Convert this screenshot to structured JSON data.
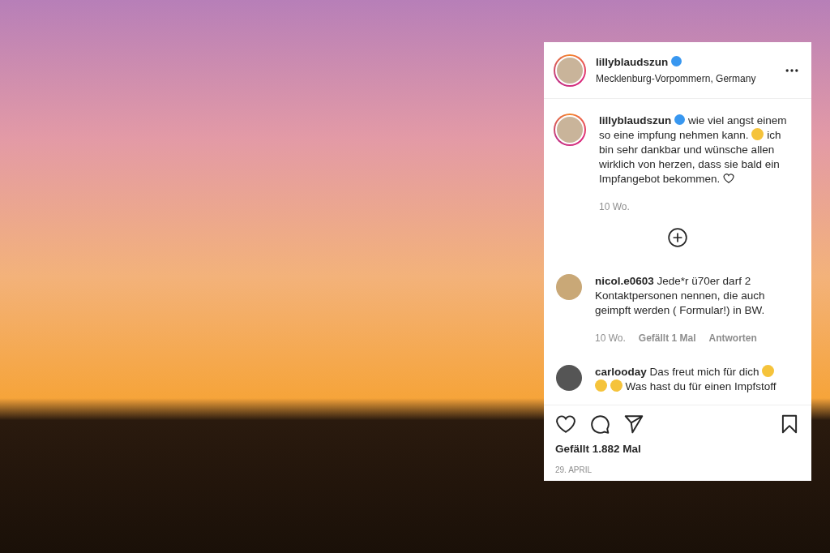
{
  "post": {
    "author": {
      "username": "lillyblaudszun",
      "verified": true,
      "location": "Mecklenburg-Vorpommern, Germany"
    },
    "caption": {
      "username": "lillyblaudszun",
      "verified": true,
      "time": "10 Wo.",
      "lines": [
        [
          {
            "kind": "text",
            "text": "wie viel angst einem"
          }
        ],
        [
          {
            "kind": "text",
            "text": "so eine impfung nehmen kann."
          },
          {
            "kind": "emoji"
          },
          {
            "kind": "text",
            "text": "ich"
          }
        ],
        [
          {
            "kind": "text",
            "text": "bin sehr dankbar und wünsche allen"
          }
        ],
        [
          {
            "kind": "text",
            "text": "wirklich von herzen, dass sie bald ein"
          }
        ],
        [
          {
            "kind": "text",
            "text": "Impfangebot bekommen."
          },
          {
            "kind": "heart"
          }
        ]
      ]
    },
    "comments": [
      {
        "username": "nicol.e0603",
        "time": "10 Wo.",
        "likes": "Gefällt 1 Mal",
        "reply": "Antworten",
        "lines": [
          [
            {
              "kind": "text",
              "text": "Jede*r ü70er darf 2"
            }
          ],
          [
            {
              "kind": "text",
              "text": "Kontaktpersonen nennen, die auch"
            }
          ],
          [
            {
              "kind": "text",
              "text": "geimpft werden ( Formular!) in BW."
            }
          ]
        ]
      },
      {
        "username": "carlooday",
        "lines": [
          [
            {
              "kind": "text",
              "text": "Das freut mich für dich"
            },
            {
              "kind": "emoji"
            }
          ],
          [
            {
              "kind": "emoji"
            },
            {
              "kind": "emoji"
            },
            {
              "kind": "text",
              "text": "Was hast du für einen Impfstoff"
            }
          ]
        ]
      }
    ],
    "likes": "Gefällt 1.882 Mal",
    "date": "29. APRIL"
  }
}
